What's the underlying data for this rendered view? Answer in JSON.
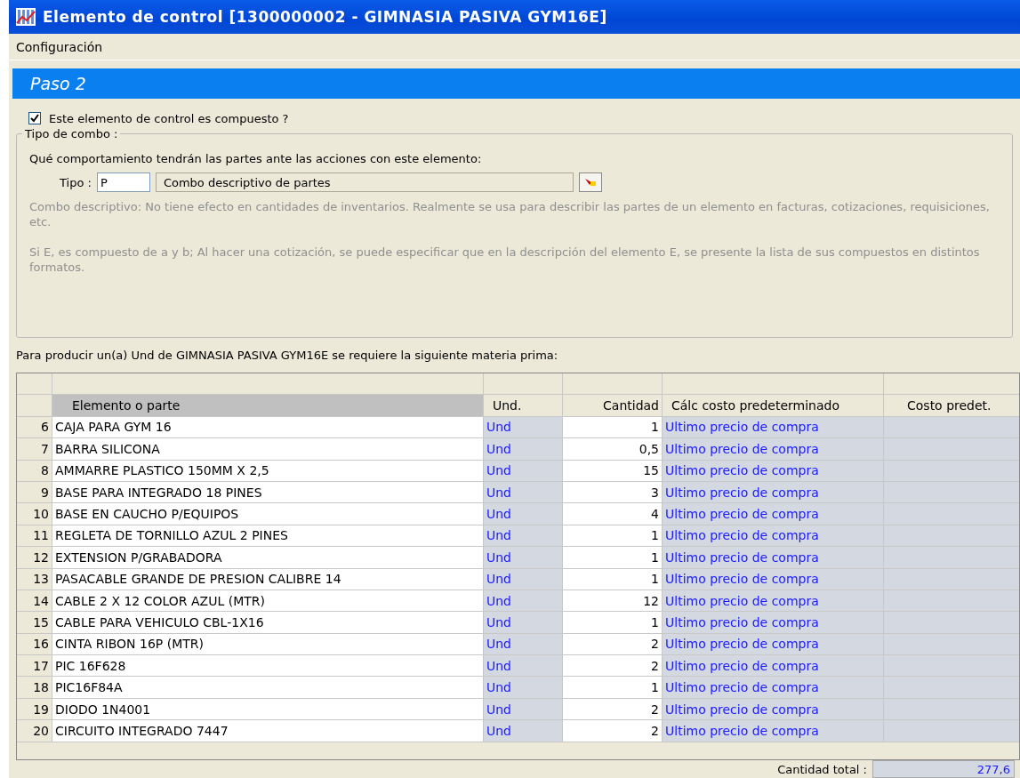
{
  "window": {
    "title": "Elemento de control [1300000002 - GIMNASIA PASIVA GYM16E]"
  },
  "menu": [
    "Configuración"
  ],
  "step": {
    "title": "Paso 2"
  },
  "compound": {
    "label": "Este elemento de control es compuesto ?",
    "checked": true
  },
  "combo_group": {
    "legend": "Tipo de combo :",
    "question": "Qué comportamiento tendrán las partes ante las acciones con este elemento:",
    "type_label": "Tipo :",
    "type_value": "P",
    "type_description": "Combo descriptivo de partes",
    "help_1": "Combo descriptivo: No tiene efecto en cantidades de inventarios. Realmente se usa para describir las partes de un elemento en facturas, cotizaciones, requisiciones, etc.",
    "help_2": "Si E, es compuesto de a y b; Al hacer una cotización, se puede especificar que en la descripción del elemento E, se presente la lista de sus compuestos en distintos formatos."
  },
  "requirement_text": "Para producir un(a) Und de GIMNASIA PASIVA GYM16E se requiere la siguiente materia prima:",
  "table": {
    "columns": [
      "Elemento o parte",
      "Und.",
      "Cantidad",
      "Cálc costo predeterminado",
      "Costo predet."
    ],
    "rows": [
      {
        "n": "6",
        "part": "CAJA PARA GYM 16",
        "unit": "Und",
        "qty": "1",
        "calc": "Ultimo precio de compra"
      },
      {
        "n": "7",
        "part": "BARRA SILICONA",
        "unit": "Und",
        "qty": "0,5",
        "calc": "Ultimo precio de compra"
      },
      {
        "n": "8",
        "part": "AMMARRE PLASTICO 150MM X 2,5",
        "unit": "Und",
        "qty": "15",
        "calc": "Ultimo precio de compra"
      },
      {
        "n": "9",
        "part": "BASE PARA INTEGRADO 18 PINES",
        "unit": "Und",
        "qty": "3",
        "calc": "Ultimo precio de compra"
      },
      {
        "n": "10",
        "part": "BASE EN CAUCHO P/EQUIPOS",
        "unit": "Und",
        "qty": "4",
        "calc": "Ultimo precio de compra"
      },
      {
        "n": "11",
        "part": "REGLETA DE TORNILLO AZUL 2 PINES",
        "unit": "Und",
        "qty": "1",
        "calc": "Ultimo precio de compra"
      },
      {
        "n": "12",
        "part": "EXTENSION P/GRABADORA",
        "unit": "Und",
        "qty": "1",
        "calc": "Ultimo precio de compra"
      },
      {
        "n": "13",
        "part": "PASACABLE GRANDE DE PRESION CALIBRE 14",
        "unit": "Und",
        "qty": "1",
        "calc": "Ultimo precio de compra"
      },
      {
        "n": "14",
        "part": "CABLE 2 X 12 COLOR AZUL (MTR)",
        "unit": "Und",
        "qty": "12",
        "calc": "Ultimo precio de compra"
      },
      {
        "n": "15",
        "part": "CABLE PARA VEHICULO CBL-1X16",
        "unit": "Und",
        "qty": "1",
        "calc": "Ultimo precio de compra"
      },
      {
        "n": "16",
        "part": "CINTA RIBON 16P (MTR)",
        "unit": "Und",
        "qty": "2",
        "calc": "Ultimo precio de compra"
      },
      {
        "n": "17",
        "part": "PIC 16F628",
        "unit": "Und",
        "qty": "2",
        "calc": "Ultimo precio de compra"
      },
      {
        "n": "18",
        "part": "PIC16F84A",
        "unit": "Und",
        "qty": "1",
        "calc": "Ultimo precio de compra"
      },
      {
        "n": "19",
        "part": "DIODO 1N4001",
        "unit": "Und",
        "qty": "2",
        "calc": "Ultimo precio de compra"
      },
      {
        "n": "20",
        "part": "CIRCUITO INTEGRADO 7447",
        "unit": "Und",
        "qty": "2",
        "calc": "Ultimo precio de compra"
      }
    ]
  },
  "total": {
    "label": "Cantidad total :",
    "value": "277,6"
  }
}
